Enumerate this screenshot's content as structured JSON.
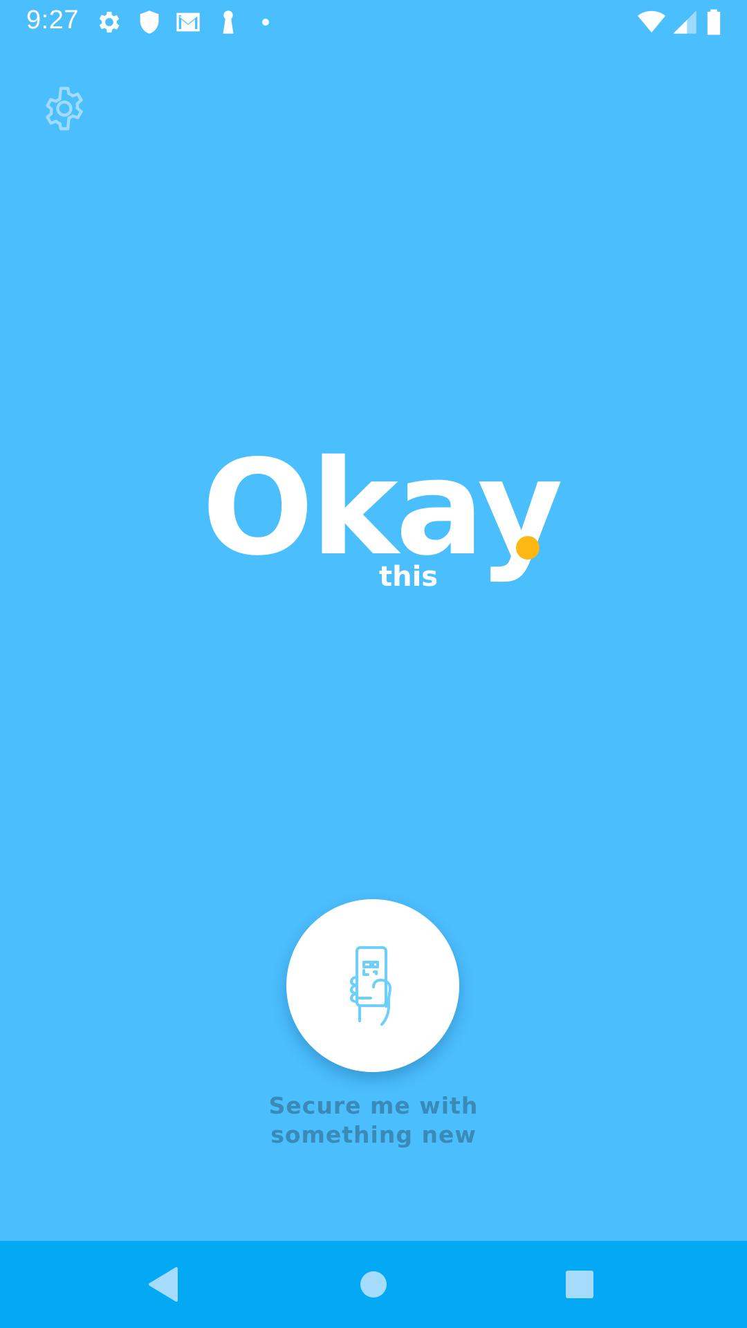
{
  "status_bar": {
    "time": "9:27",
    "left_icons": [
      "gear-icon",
      "shield-icon",
      "mail-icon",
      "keyhole-icon",
      "dot-icon"
    ],
    "right_icons": [
      "wifi-icon",
      "cell-signal-icon",
      "battery-icon"
    ]
  },
  "toolbar": {
    "settings_icon": "gear-icon"
  },
  "logo": {
    "word": "Okay",
    "subtext": "this",
    "dot_color": "#fdb813"
  },
  "action": {
    "icon": "phone-in-hand-icon",
    "label_line1": "Secure me with",
    "label_line2": "something new"
  },
  "nav_bar": {
    "buttons": [
      "back-icon",
      "home-icon",
      "recents-icon"
    ]
  },
  "colors": {
    "background": "#4bbefd",
    "nav_bar": "#03a9f4",
    "accent": "#fdb813",
    "label_text": "#3a8ab8"
  }
}
